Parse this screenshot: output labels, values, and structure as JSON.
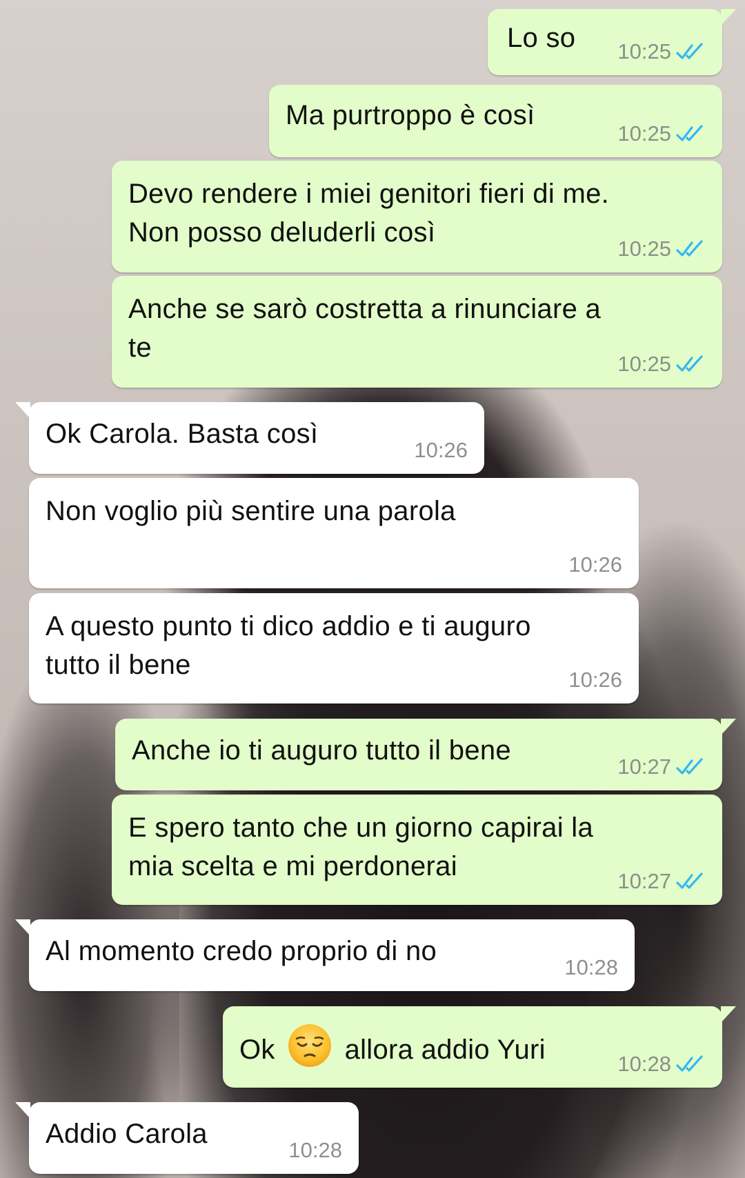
{
  "conversation": {
    "messages": [
      {
        "dir": "out",
        "text": "Lo so",
        "time": "10:25",
        "status_icon": "read-double-check-icon"
      },
      {
        "dir": "out",
        "text": "Ma purtroppo è così",
        "time": "10:25",
        "status_icon": "read-double-check-icon"
      },
      {
        "dir": "out",
        "text": "Devo rendere i miei genitori fieri di me.\nNon posso deluderli così",
        "time": "10:25",
        "status_icon": "read-double-check-icon"
      },
      {
        "dir": "out",
        "text": "Anche se sarò costretta a rinunciare a\nte",
        "time": "10:25",
        "status_icon": "read-double-check-icon"
      },
      {
        "dir": "in",
        "text": "Ok Carola. Basta così",
        "time": "10:26"
      },
      {
        "dir": "in",
        "text": "Non voglio più sentire una parola",
        "time": "10:26"
      },
      {
        "dir": "in",
        "text": "A questo punto ti dico addio e ti auguro\ntutto il bene",
        "time": "10:26"
      },
      {
        "dir": "out",
        "text": "Anche io ti auguro tutto il bene",
        "time": "10:27",
        "status_icon": "read-double-check-icon"
      },
      {
        "dir": "out",
        "text": "E spero tanto che un giorno capirai la\nmia scelta e mi perdonerai",
        "time": "10:27",
        "status_icon": "read-double-check-icon"
      },
      {
        "dir": "in",
        "text": "Al momento credo proprio di no",
        "time": "10:28"
      },
      {
        "dir": "out",
        "text_before": "Ok",
        "emoji": "pensive-face-emoji",
        "text_after": "allora addio Yuri",
        "time": "10:28",
        "status_icon": "read-double-check-icon"
      },
      {
        "dir": "in",
        "text": "Addio Carola",
        "time": "10:28"
      }
    ]
  },
  "colors": {
    "outgoing_bubble": "#e2fdc9",
    "incoming_bubble": "#ffffff",
    "read_ticks": "#34b7f1",
    "timestamp": "#8a8f89"
  }
}
